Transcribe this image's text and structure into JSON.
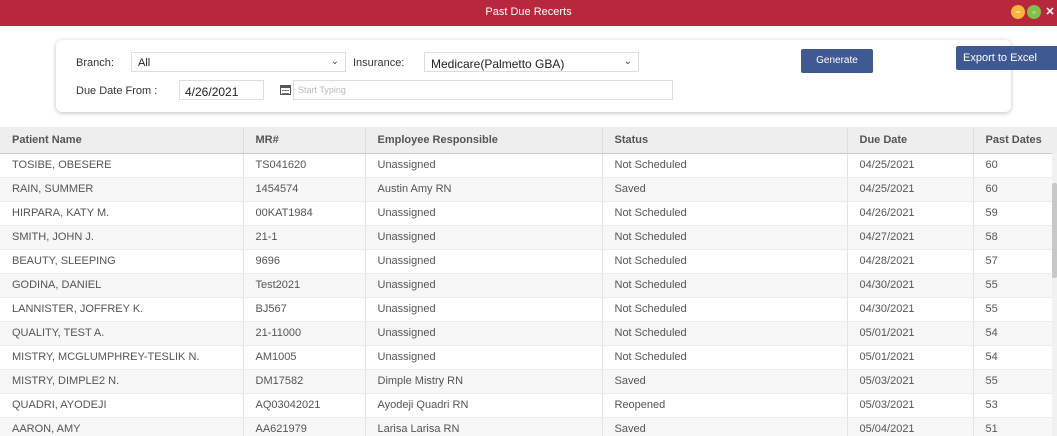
{
  "window": {
    "title": "Past Due Recerts",
    "colors": {
      "titlebar": "#b8283d",
      "button": "#3f5a92"
    }
  },
  "filters": {
    "branch_label": "Branch:",
    "branch_value": "All",
    "insurance_label": "Insurance:",
    "insurance_value": "Medicare(Palmetto GBA)",
    "due_from_label": "Due Date From :",
    "due_from_value": "4/26/2021",
    "due_to_placeholder": "Start Typing",
    "generate_label": "Generate",
    "export_label": "Export to Excel"
  },
  "table": {
    "columns": [
      "Patient Name",
      "MR#",
      "Employee Responsible",
      "Status",
      "Due Date",
      "Past Dates"
    ],
    "rows": [
      [
        "TOSIBE, OBESERE",
        "TS041620",
        "Unassigned",
        "Not Scheduled",
        "04/25/2021",
        "60"
      ],
      [
        "RAIN, SUMMER",
        "1454574",
        "Austin Amy RN",
        "Saved",
        "04/25/2021",
        "60"
      ],
      [
        "HIRPARA, KATY M.",
        "00KAT1984",
        "Unassigned",
        "Not Scheduled",
        "04/26/2021",
        "59"
      ],
      [
        "SMITH, JOHN J.",
        "21-1",
        "Unassigned",
        "Not Scheduled",
        "04/27/2021",
        "58"
      ],
      [
        "BEAUTY, SLEEPING",
        "9696",
        "Unassigned",
        "Not Scheduled",
        "04/28/2021",
        "57"
      ],
      [
        "GODINA, DANIEL",
        "Test2021",
        "Unassigned",
        "Not Scheduled",
        "04/30/2021",
        "55"
      ],
      [
        "LANNISTER, JOFFREY K.",
        "BJ567",
        "Unassigned",
        "Not Scheduled",
        "04/30/2021",
        "55"
      ],
      [
        "QUALITY, TEST A.",
        "21-11000",
        "Unassigned",
        "Not Scheduled",
        "05/01/2021",
        "54"
      ],
      [
        "MISTRY, MCGLUMPHREY-TESLIK N.",
        "AM1005",
        "Unassigned",
        "Not Scheduled",
        "05/01/2021",
        "54"
      ],
      [
        "MISTRY, DIMPLE2 N.",
        "DM17582",
        "Dimple Mistry RN",
        "Saved",
        "05/03/2021",
        "55"
      ],
      [
        "QUADRI, AYODEJI",
        "AQ03042021",
        "Ayodeji Quadri RN",
        "Reopened",
        "05/03/2021",
        "53"
      ],
      [
        "AARON, AMY",
        "AA621979",
        "Larisa Larisa RN",
        "Saved",
        "05/04/2021",
        "51"
      ]
    ]
  }
}
